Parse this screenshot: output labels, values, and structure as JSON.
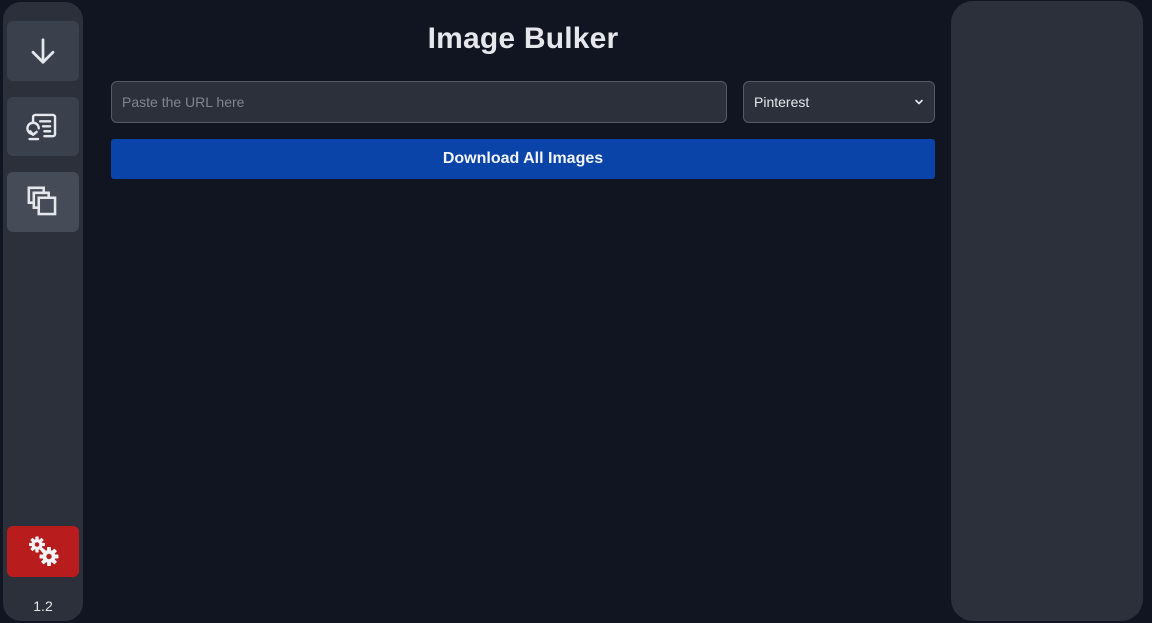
{
  "app": {
    "title": "Image Bulker",
    "version": "1.2"
  },
  "sidebar": {
    "items": [
      {
        "name": "download",
        "icon": "arrow-down-icon"
      },
      {
        "name": "history",
        "icon": "history-list-icon"
      },
      {
        "name": "gallery",
        "icon": "stacked-squares-icon"
      }
    ],
    "settings": {
      "icon": "gears-icon",
      "color": "#b91c1c"
    }
  },
  "main": {
    "url_input": {
      "placeholder": "Paste the URL here",
      "value": ""
    },
    "platform_select": {
      "selected": "Pinterest"
    },
    "download_button": {
      "label": "Download All Images",
      "color": "#0b44a8"
    }
  },
  "colors": {
    "background": "#111522",
    "panel": "#2b303b",
    "accent": "#0b44a8",
    "danger": "#b91c1c"
  }
}
